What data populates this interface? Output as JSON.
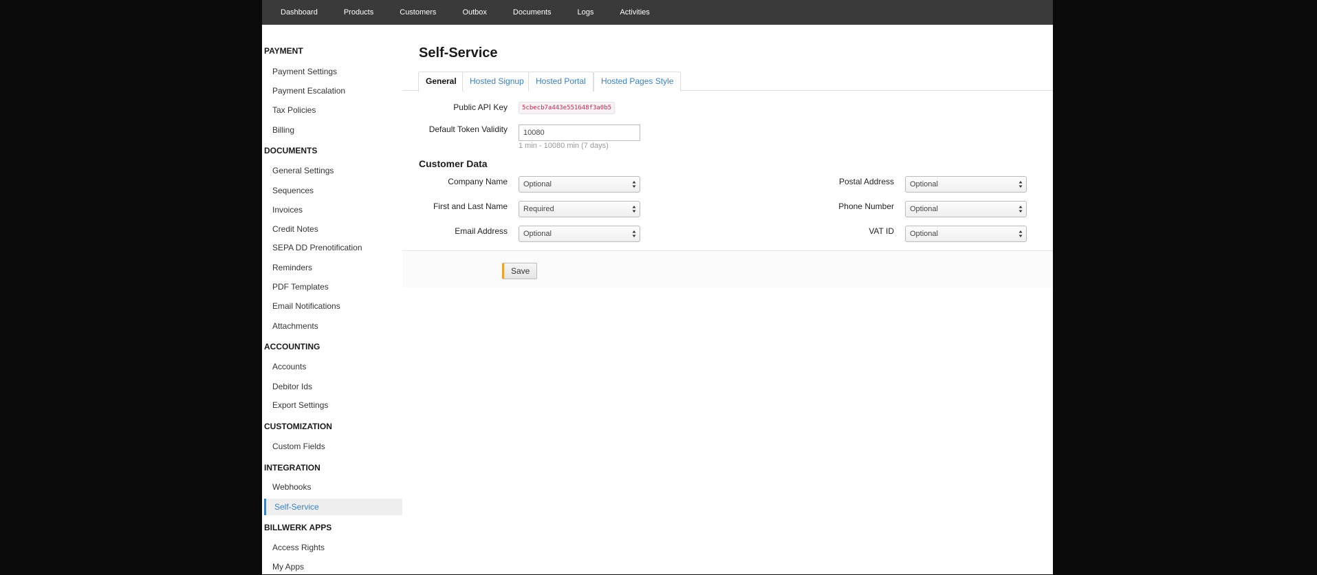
{
  "topnav": {
    "items": [
      "Dashboard",
      "Products",
      "Customers",
      "Outbox",
      "Documents",
      "Logs",
      "Activities"
    ]
  },
  "sidebar": {
    "sections": [
      {
        "title": "PAYMENT",
        "items": [
          "Payment Settings",
          "Payment Escalation",
          "Tax Policies",
          "Billing"
        ]
      },
      {
        "title": "DOCUMENTS",
        "items": [
          "General Settings",
          "Sequences",
          "Invoices",
          "Credit Notes",
          "SEPA DD Prenotification",
          "Reminders",
          "PDF Templates",
          "Email Notifications",
          "Attachments"
        ]
      },
      {
        "title": "ACCOUNTING",
        "items": [
          "Accounts",
          "Debitor Ids",
          "Export Settings"
        ]
      },
      {
        "title": "CUSTOMIZATION",
        "items": [
          "Custom Fields"
        ]
      },
      {
        "title": "INTEGRATION",
        "items": [
          "Webhooks",
          "Self-Service"
        ]
      },
      {
        "title": "BILLWERK APPS",
        "items": [
          "Access Rights",
          "My Apps"
        ]
      }
    ],
    "active_item": "Self-Service"
  },
  "main": {
    "title": "Self-Service",
    "tabs": [
      "General",
      "Hosted Signup",
      "Hosted Portal",
      "Hosted Pages Style"
    ],
    "active_tab": "General",
    "api_key_label": "Public API Key",
    "api_key_value": "5cbecb7a443e551648f3a0b5",
    "token_label": "Default Token Validity",
    "token_value": "10080",
    "token_help": "1 min - 10080 min (7 days)",
    "customer_data_title": "Customer Data",
    "fields_left": [
      {
        "label": "Company Name",
        "value": "Optional"
      },
      {
        "label": "First and Last Name",
        "value": "Required"
      },
      {
        "label": "Email Address",
        "value": "Optional"
      }
    ],
    "fields_right": [
      {
        "label": "Postal Address",
        "value": "Optional"
      },
      {
        "label": "Phone Number",
        "value": "Optional"
      },
      {
        "label": "VAT ID",
        "value": "Optional"
      }
    ],
    "save_label": "Save"
  },
  "colors": {
    "accent": "#3a7fc1",
    "nav_bg": "#3a3a3a",
    "save_accent": "#f0a030",
    "api_key_text": "#c7254e"
  }
}
